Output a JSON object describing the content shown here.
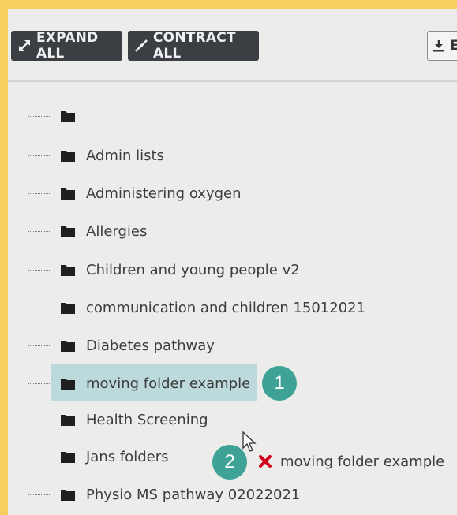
{
  "toolbar": {
    "expand_label": "EXPAND ALL",
    "contract_label": "CONTRACT ALL",
    "export_label": "E"
  },
  "tree": {
    "root_label": "",
    "items": [
      {
        "label": "Admin lists"
      },
      {
        "label": "Administering oxygen"
      },
      {
        "label": "Allergies"
      },
      {
        "label": "Children and young people v2"
      },
      {
        "label": "communication and children 15012021"
      },
      {
        "label": "Diabetes pathway"
      },
      {
        "label": "moving folder example",
        "selected": true
      },
      {
        "label": "Health Screening"
      },
      {
        "label": "Jans folders"
      },
      {
        "label": "Physio MS pathway 02022021"
      }
    ]
  },
  "annotations": {
    "step1": "1",
    "step2": "2"
  },
  "drag": {
    "label": "moving folder example",
    "status_icon": "cross-icon"
  },
  "colors": {
    "highlight": "#bcd9dc",
    "badge": "#3ea296",
    "button": "#3b3f43",
    "cross": "#d0021b"
  }
}
